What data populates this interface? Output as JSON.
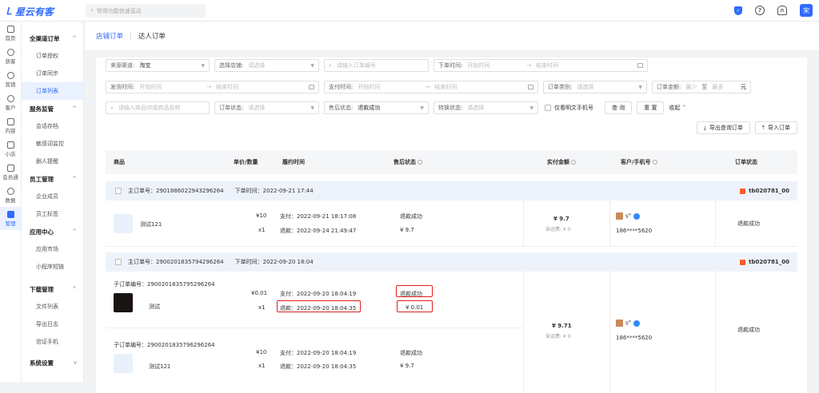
{
  "topbar": {
    "logo": "星云有客",
    "search_placeholder": "常用功能快速直达",
    "avatar": "宋"
  },
  "rail": [
    {
      "label": "首页"
    },
    {
      "label": "获客"
    },
    {
      "label": "营销"
    },
    {
      "label": "客户"
    },
    {
      "label": "内容"
    },
    {
      "label": "小店"
    },
    {
      "label": "会员通"
    },
    {
      "label": "数据"
    },
    {
      "label": "管理"
    }
  ],
  "sidebar": {
    "g1": "全渠道订单",
    "g1_items": [
      "订单授权",
      "订单同步",
      "订单列表"
    ],
    "g2": "服务监管",
    "g2_items": [
      "会话存档",
      "敏感词监控",
      "删人提醒"
    ],
    "g3": "员工管理",
    "g3_items": [
      "企业成员",
      "员工标签"
    ],
    "g4": "应用中心",
    "g4_items": [
      "应用市场",
      "小程序短链"
    ],
    "g5": "下载管理",
    "g5_items": [
      "文件列表",
      "导出日志",
      "验证手机"
    ],
    "g6": "系统设置"
  },
  "tabs": {
    "t1": "店铺订单",
    "t2": "达人订单"
  },
  "filters": {
    "channel_label": "来源渠道:",
    "channel_value": "淘宝",
    "shop_label": "选择店铺:",
    "select_ph": "请选择",
    "order_no_ph": "请输入订单编号",
    "order_time_label": "下单时间:",
    "start_ph": "开始时间",
    "end_ph": "结束时间",
    "ship_time_label": "发货时间:",
    "pay_time_label": "支付时间:",
    "order_type_label": "订单类别:",
    "amount_label": "订单金额:",
    "min_ph": "最少",
    "to": "至",
    "max_ph": "最多",
    "unit": "元",
    "product_ph": "请输入商品ID或商品名称",
    "order_status_label": "订单状态:",
    "after_sale_label": "售后状态:",
    "after_sale_value": "退款成功",
    "convert_label": "转换状态:",
    "plain_phone": "仅看明文手机号",
    "query_btn": "查 询",
    "reset_btn": "重 置",
    "collapse": "收起"
  },
  "actions": {
    "export": "导出查询订单",
    "import": "导入订单"
  },
  "table": {
    "headers": [
      "商品",
      "单价/数量",
      "履约时间",
      "售后状态",
      "实付金额",
      "客户/手机号",
      "订单状态"
    ]
  },
  "orders": [
    {
      "main_label": "主订单号：",
      "main_no": "2901886022943296264",
      "time_label": "下单时间：",
      "time": "2022-09-21 17:44",
      "shop": "tb020781_00",
      "items": [
        {
          "name": "测试121",
          "price": "¥10",
          "qty": "x1",
          "pay": "支付：2022-09-21 18:17:08",
          "refund": "退款：2022-09-24 21:49:47",
          "status": "退款成功",
          "amount": "¥ 9.7"
        }
      ],
      "total": "¥ 9.7",
      "shipping": "含运费: ¥ 0",
      "customer": "s°",
      "phone": "186****5620",
      "order_status": "退款成功"
    },
    {
      "main_label": "主订单号：",
      "main_no": "2900201835794296264",
      "time_label": "下单时间：",
      "time": "2022-09-20 18:04",
      "shop": "tb020781_00",
      "items": [
        {
          "sub_label": "子订单编号：",
          "sub_no": "2900201835795296264",
          "name": "测试",
          "price": "¥0.01",
          "qty": "x1",
          "pay": "支付：2022-09-20 18:04:19",
          "refund": "退款：2022-09-20 18:04:35",
          "status": "退款成功",
          "amount": "¥ 0.01"
        },
        {
          "sub_label": "子订单编号：",
          "sub_no": "2900201835796296264",
          "name": "测试121",
          "price": "¥10",
          "qty": "x1",
          "pay": "支付：2022-09-20 18:04:19",
          "refund": "退款：2022-09-20 18:04:35",
          "status": "退款成功",
          "amount": "¥ 9.7"
        }
      ],
      "total": "¥ 9.71",
      "shipping": "含运费: ¥ 0",
      "customer": "s°",
      "phone": "186****5620",
      "order_status": "退款成功"
    }
  ]
}
